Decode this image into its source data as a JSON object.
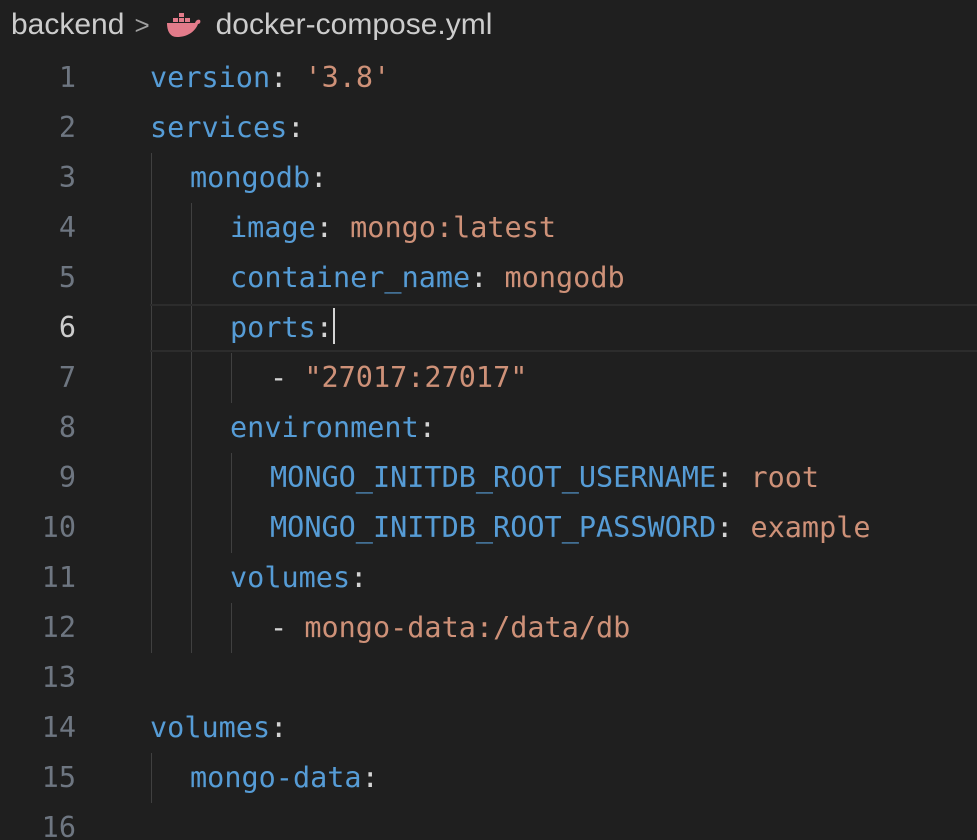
{
  "breadcrumb": {
    "folder": "backend",
    "separator": ">",
    "file_icon": "docker-whale-icon",
    "file": "docker-compose.yml"
  },
  "colors": {
    "background": "#1f1f1f",
    "key": "#569cd6",
    "string": "#ce9178",
    "line_number": "#6e7681",
    "active_line_number": "#cccccc"
  },
  "cursor": {
    "line": 6
  },
  "lines": [
    {
      "n": "1",
      "key": "version",
      "colon": ":",
      "value": " '3.8'"
    },
    {
      "n": "2",
      "key": "services",
      "colon": ":"
    },
    {
      "n": "3",
      "key": "mongodb",
      "colon": ":"
    },
    {
      "n": "4",
      "key": "image",
      "colon": ":",
      "value": " mongo:latest"
    },
    {
      "n": "5",
      "key": "container_name",
      "colon": ":",
      "value": " mongodb"
    },
    {
      "n": "6",
      "key": "ports",
      "colon": ":"
    },
    {
      "n": "7",
      "dash": "- ",
      "value": "\"27017:27017\""
    },
    {
      "n": "8",
      "key": "environment",
      "colon": ":"
    },
    {
      "n": "9",
      "key": "MONGO_INITDB_ROOT_USERNAME",
      "colon": ":",
      "value": " root"
    },
    {
      "n": "10",
      "key": "MONGO_INITDB_ROOT_PASSWORD",
      "colon": ":",
      "value": " example"
    },
    {
      "n": "11",
      "key": "volumes",
      "colon": ":"
    },
    {
      "n": "12",
      "dash": "- ",
      "value": "mongo-data:/data/db"
    },
    {
      "n": "13"
    },
    {
      "n": "14",
      "key": "volumes",
      "colon": ":"
    },
    {
      "n": "15",
      "key": "mongo-data",
      "colon": ":"
    },
    {
      "n": "16"
    }
  ]
}
